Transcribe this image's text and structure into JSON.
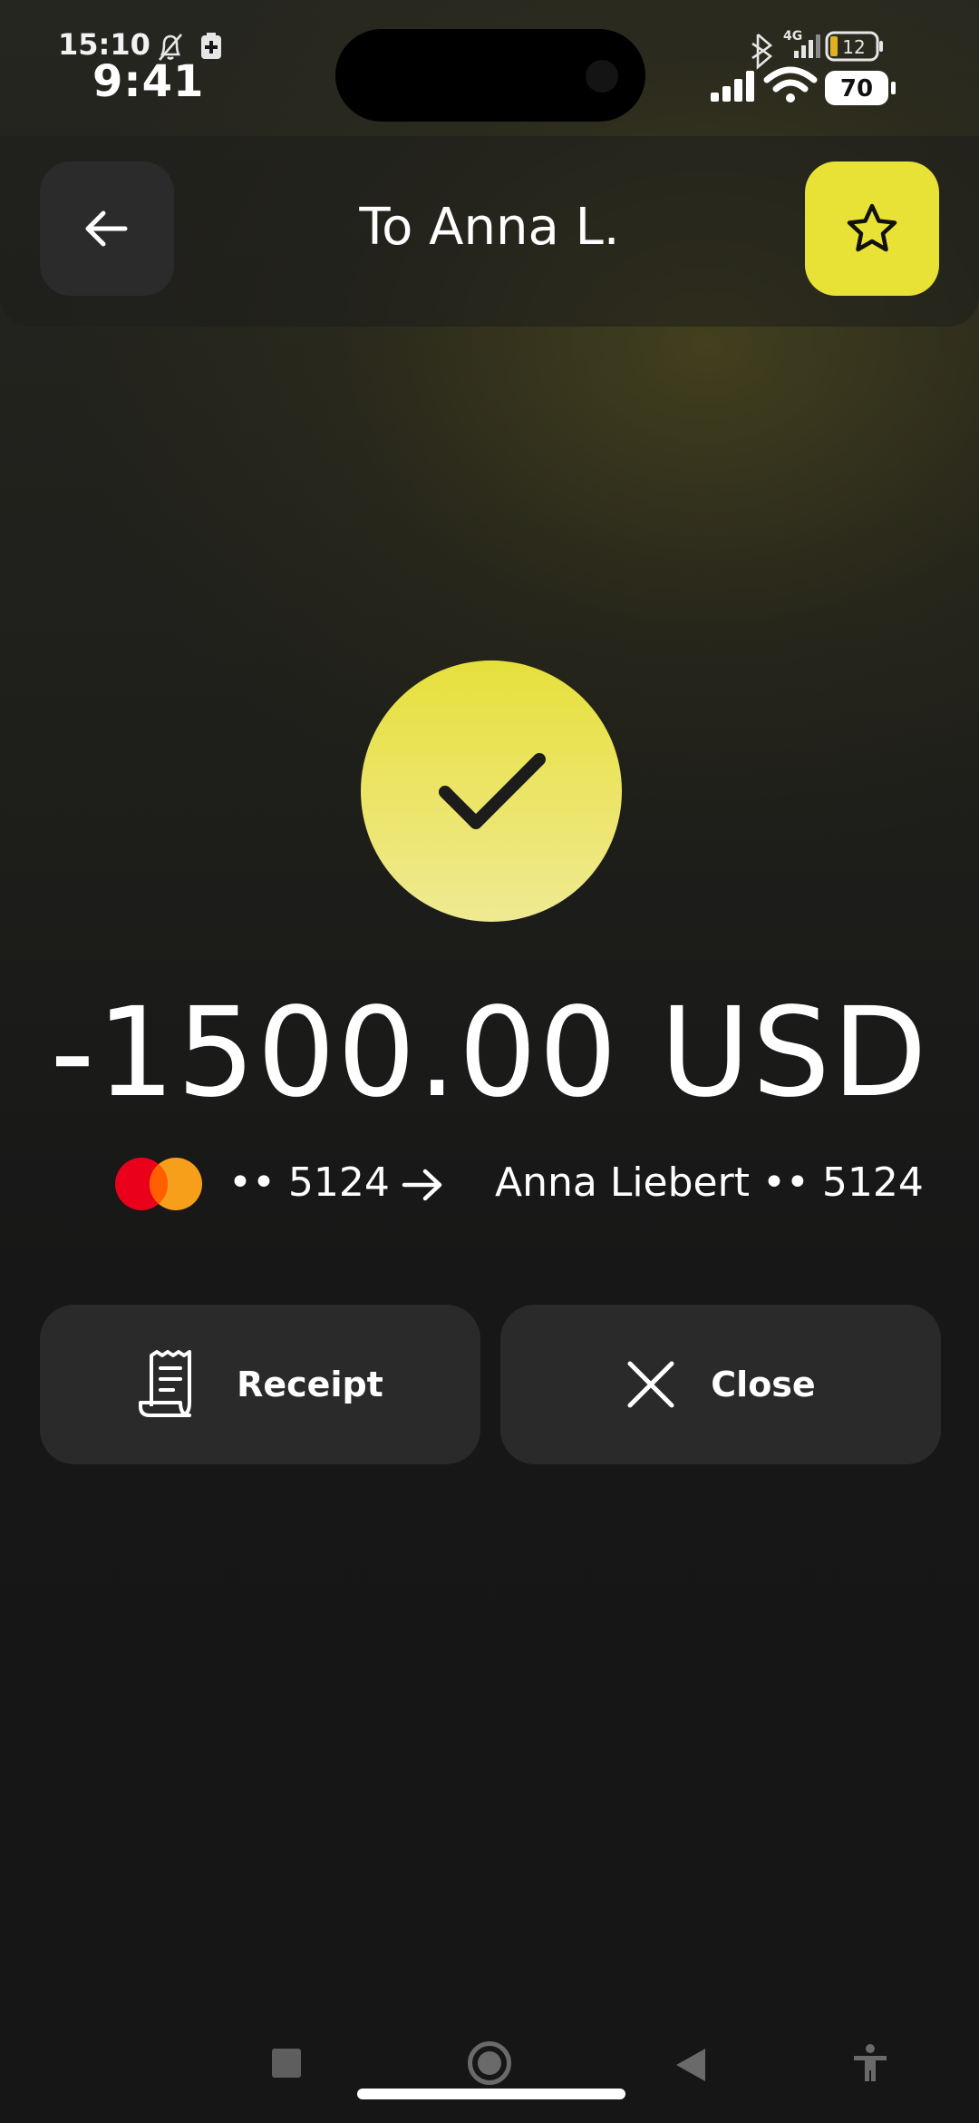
{
  "status_bar": {
    "android_time": "15:10",
    "ios_time": "9:41",
    "network_label": "4G",
    "battery_small": "12",
    "battery_large": "70"
  },
  "header": {
    "title": "To Anna L.",
    "back_icon": "arrow-left-icon",
    "favorite_icon": "star-icon",
    "favorite_color": "#e8e236"
  },
  "transaction": {
    "status_icon": "checkmark-icon",
    "amount": "-1500.00 USD",
    "from_card_mask": "•• 5124",
    "card_brand_icon": "mastercard-icon",
    "direction_icon": "arrow-right-icon",
    "recipient": "Anna Liebert •• 5124"
  },
  "actions": {
    "receipt_label": "Receipt",
    "receipt_icon": "receipt-icon",
    "close_label": "Close",
    "close_icon": "close-icon"
  },
  "theme": {
    "accent": "#e8e236",
    "background": "#161616",
    "button_bg": "#2a2a2a"
  }
}
